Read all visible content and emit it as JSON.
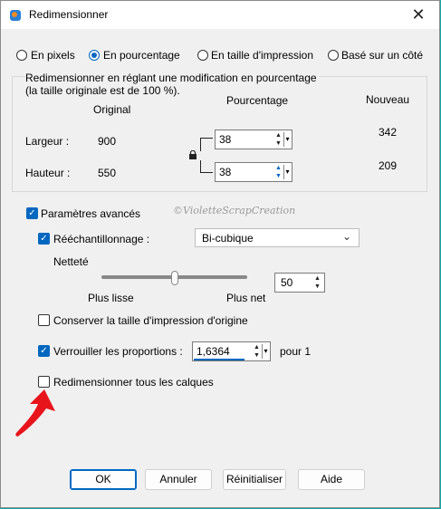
{
  "window": {
    "title": "Redimensionner",
    "close_glyph": "✕"
  },
  "radios": [
    {
      "label": "En pixels",
      "checked": false
    },
    {
      "label": "En pourcentage",
      "checked": true
    },
    {
      "label": "En taille d'impression",
      "checked": false
    },
    {
      "label": "Basé sur un côté",
      "checked": false
    }
  ],
  "group": {
    "caption_line1": "Redimensionner en réglant une modification en pourcentage",
    "caption_line2": "(la taille originale est de 100 %).",
    "col_original": "Original",
    "col_percent": "Pourcentage",
    "col_new": "Nouveau",
    "width_label": "Largeur :",
    "height_label": "Hauteur :",
    "width_original": "900",
    "height_original": "550",
    "width_percent": "38",
    "height_percent": "38",
    "width_new": "342",
    "height_new": "209"
  },
  "advanced": {
    "label": "Paramètres avancés",
    "checked": true,
    "resample_label": "Rééchantillonnage :",
    "resample_checked": true,
    "resample_value": "Bi-cubique",
    "sharpness_label": "Netteté",
    "sharpness_value": "50",
    "sharpness_fraction": 0.5,
    "slider_left_label": "Plus lisse",
    "slider_right_label": "Plus net",
    "keep_print_size_label": "Conserver la taille d'impression d'origine",
    "keep_print_size_checked": false,
    "lock_ratio_label": "Verrouiller les proportions :",
    "lock_ratio_checked": true,
    "ratio_value": "1,6364",
    "ratio_suffix": "pour 1",
    "resize_layers_label": "Redimensionner tous les calques",
    "resize_layers_checked": false
  },
  "watermark": "©VioletteScrapCreation",
  "buttons": {
    "ok": "OK",
    "cancel": "Annuler",
    "reset": "Réinitialiser",
    "help": "Aide"
  },
  "colors": {
    "accent": "#0067c0",
    "arrow": "#e8141c",
    "desktop": "#18a8a8"
  }
}
